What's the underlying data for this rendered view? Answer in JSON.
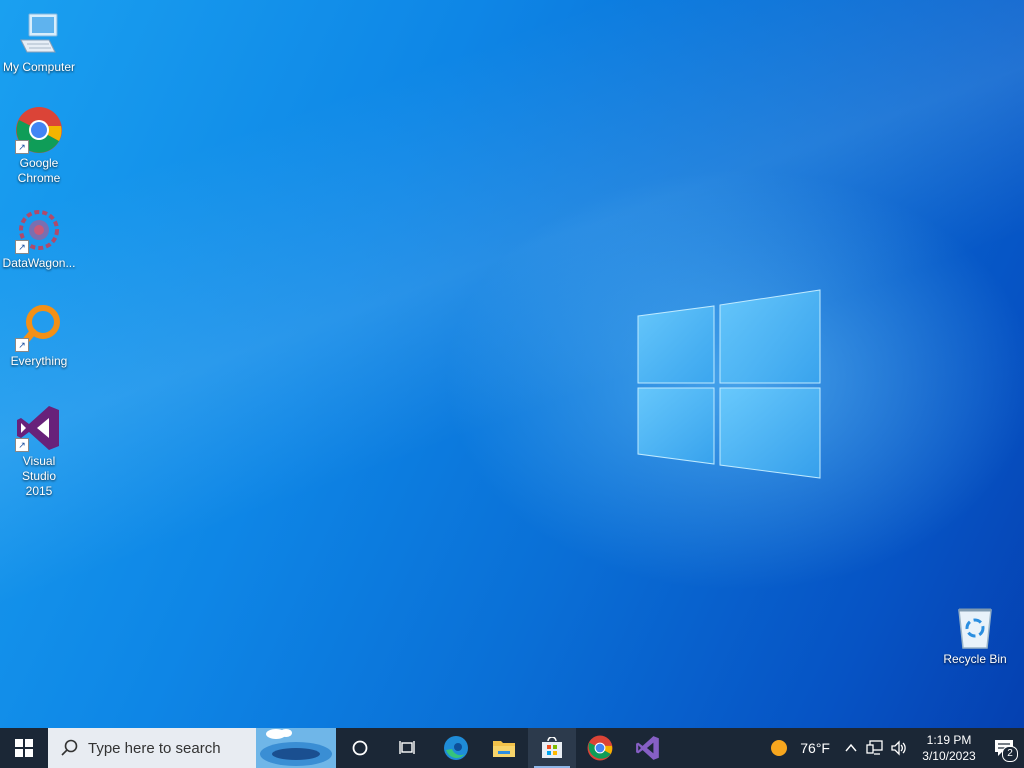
{
  "desktop": {
    "icons": [
      {
        "label": "My Computer",
        "icon": "computer-icon"
      },
      {
        "label": "Google Chrome",
        "icon": "chrome-icon"
      },
      {
        "label": "DataWagon...",
        "icon": "datawagon-icon"
      },
      {
        "label": "Everything",
        "icon": "everything-icon"
      },
      {
        "label": "Visual Studio 2015",
        "icon": "visual-studio-icon"
      },
      {
        "label": "Recycle Bin",
        "icon": "recycle-bin-icon"
      }
    ]
  },
  "taskbar": {
    "search_placeholder": "Type here to search",
    "pinned": [
      "task-view-icon",
      "edge-icon",
      "file-explorer-icon",
      "store-icon",
      "chrome-icon",
      "visual-studio-icon"
    ],
    "weather": {
      "temp": "76°F"
    },
    "clock": {
      "time": "1:19 PM",
      "date": "3/10/2023"
    },
    "notifications_count": "2"
  },
  "colors": {
    "accent": "#0a6fd6",
    "taskbar": "#1b2736"
  }
}
